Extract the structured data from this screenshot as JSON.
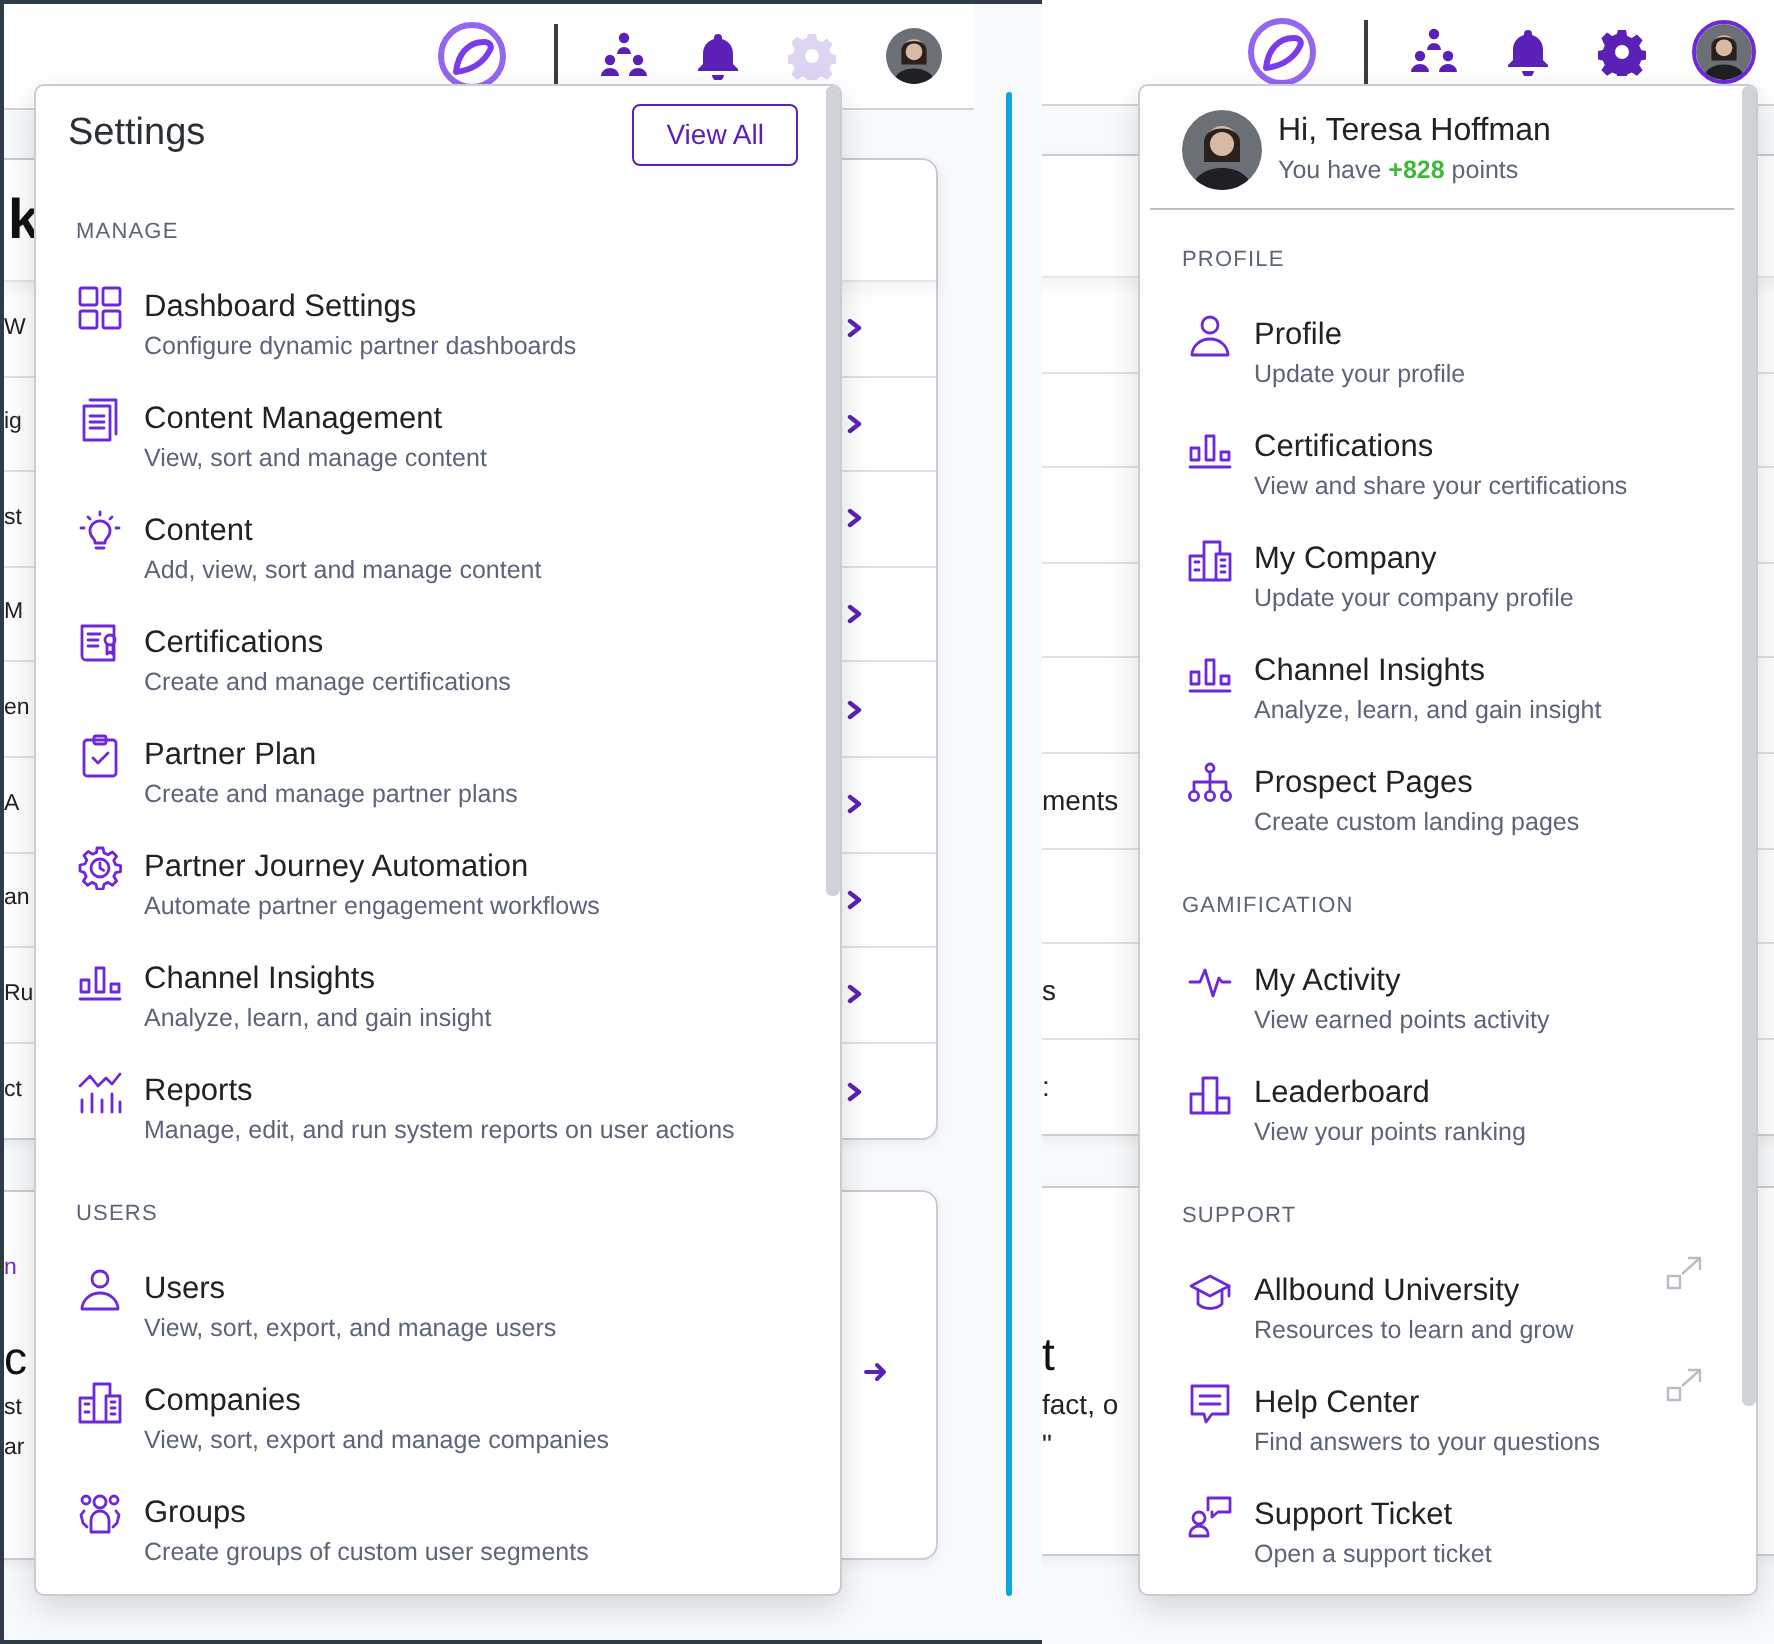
{
  "left_screen": {
    "header": {
      "settings": {
        "selected": true
      },
      "avatar": {
        "selected": false
      }
    },
    "background": {
      "heading": "k",
      "rows": [
        {
          "text": "W"
        },
        {
          "text": "ig"
        },
        {
          "text": "st"
        },
        {
          "text": "M"
        },
        {
          "text": "en"
        },
        {
          "text": "A"
        },
        {
          "text": "an"
        },
        {
          "text": "Ru"
        },
        {
          "text": "ct"
        }
      ],
      "card2": {
        "link": "n",
        "title": "c",
        "lines": [
          "st",
          "ar"
        ]
      }
    },
    "settings_menu": {
      "title": "Settings",
      "button": "View All",
      "sections": [
        {
          "heading": "MANAGE",
          "items": [
            {
              "title": "Dashboard Settings",
              "subtitle": "Configure dynamic partner dashboards"
            },
            {
              "title": "Content Management",
              "subtitle": "View, sort and manage content"
            },
            {
              "title": "Content",
              "subtitle": "Add, view, sort and manage content"
            },
            {
              "title": "Certifications",
              "subtitle": "Create and manage certifications"
            },
            {
              "title": "Partner Plan",
              "subtitle": "Create and manage partner plans"
            },
            {
              "title": "Partner Journey Automation",
              "subtitle": "Automate partner engagement workflows"
            },
            {
              "title": "Channel Insights",
              "subtitle": "Analyze, learn, and gain insight"
            },
            {
              "title": "Reports",
              "subtitle": "Manage, edit, and run system reports on user actions"
            }
          ]
        },
        {
          "heading": "USERS",
          "items": [
            {
              "title": "Users",
              "subtitle": "View, sort, export, and manage users"
            },
            {
              "title": "Companies",
              "subtitle": "View, sort, export and manage companies"
            },
            {
              "title": "Groups",
              "subtitle": "Create groups of custom user segments"
            }
          ]
        }
      ]
    }
  },
  "right_screen": {
    "header": {
      "settings": {
        "selected": false
      },
      "avatar": {
        "selected": true
      }
    },
    "background": {
      "rows": [
        {},
        {},
        {},
        {},
        {},
        {
          "text": "ments"
        },
        {},
        {
          "text": "s"
        },
        {
          "text": ":"
        }
      ],
      "card2": {
        "title": "t",
        "lines": [
          "fact, o",
          "\""
        ]
      }
    },
    "user_menu": {
      "greeting": "Hi, Teresa Hoffman",
      "points": "You have **+828** points",
      "sections": [
        {
          "heading": "PROFILE",
          "items": [
            {
              "title": "Profile",
              "subtitle": "Update your profile",
              "external": false
            },
            {
              "title": "Certifications",
              "subtitle": "View and share your certifications",
              "external": false
            },
            {
              "title": "My Company",
              "subtitle": "Update your company profile",
              "external": false
            },
            {
              "title": "Channel Insights",
              "subtitle": "Analyze, learn, and gain insight",
              "external": false
            },
            {
              "title": "Prospect Pages",
              "subtitle": "Create custom landing pages",
              "external": false
            }
          ]
        },
        {
          "heading": "GAMIFICATION",
          "items": [
            {
              "title": "My Activity",
              "subtitle": "View earned points activity",
              "external": false
            },
            {
              "title": "Leaderboard",
              "subtitle": "View your points ranking",
              "external": false
            }
          ]
        },
        {
          "heading": "SUPPORT",
          "items": [
            {
              "title": "Allbound University",
              "subtitle": "Resources to learn and grow",
              "external": true
            },
            {
              "title": "Help Center",
              "subtitle": "Find answers to your questions",
              "external": true
            },
            {
              "title": "Support Ticket",
              "subtitle": "Open a support ticket",
              "external": false
            }
          ]
        }
      ]
    }
  }
}
